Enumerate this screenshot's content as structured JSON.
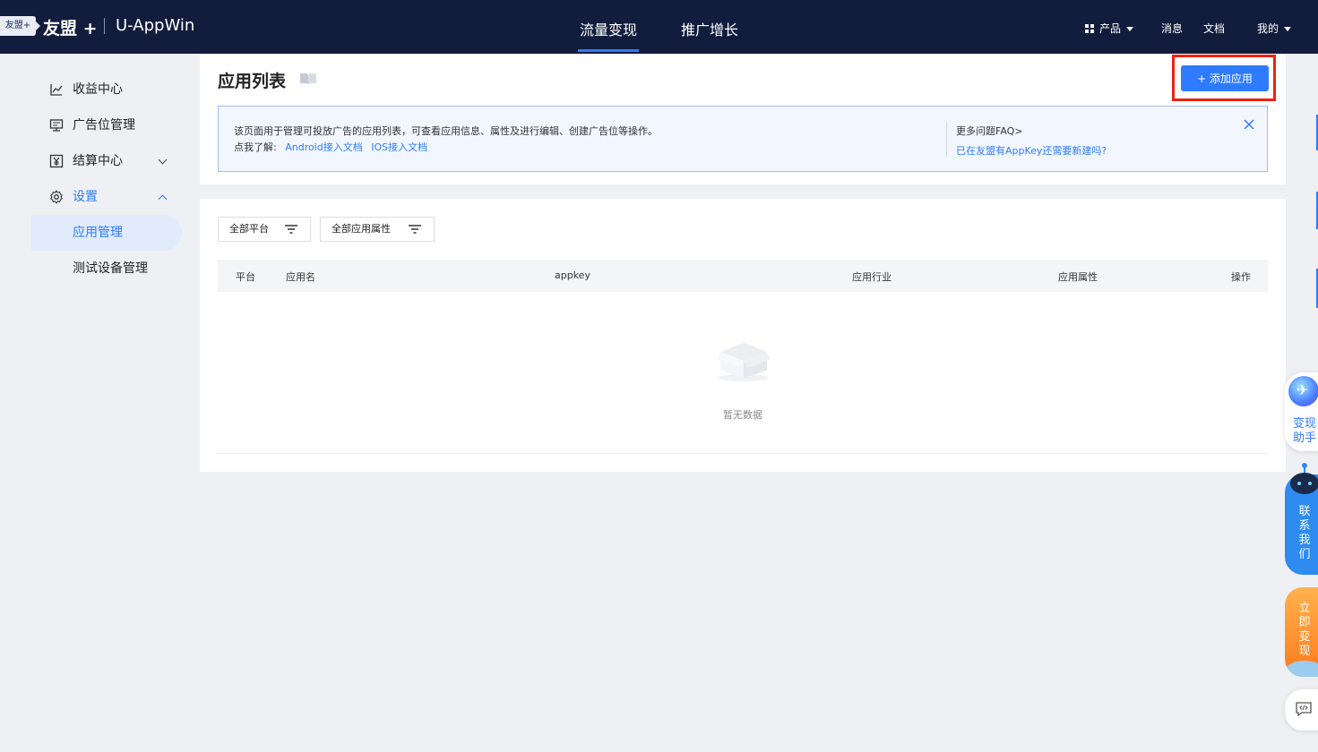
{
  "topbar": {
    "logo_badge": "友盟+",
    "brand": "友盟 +",
    "brand_sub": "U-AppWin",
    "tabs": [
      {
        "label": "流量变现",
        "active": true
      },
      {
        "label": "推广增长",
        "active": false
      }
    ],
    "right": {
      "products": "产品",
      "messages": "消息",
      "docs": "文档",
      "mine": "我的"
    }
  },
  "sidebar": {
    "items": [
      {
        "label": "收益中心",
        "icon": "chart-line-icon"
      },
      {
        "label": "广告位管理",
        "icon": "monitor-icon"
      },
      {
        "label": "结算中心",
        "icon": "yen-icon"
      },
      {
        "label": "设置",
        "icon": "gear-icon",
        "expanded": true
      },
      {
        "label": "应用管理",
        "selected": true
      },
      {
        "label": "测试设备管理"
      }
    ]
  },
  "header": {
    "title": "应用列表",
    "add_button": "+ 添加应用",
    "notice": {
      "text": "该页面用于管理可投放广告的应用列表，可查看应用信息、属性及进行编辑、创建广告位等操作。",
      "learn_prefix": "点我了解:",
      "android_link": "Android接入文档",
      "ios_link": "IOS接入文档",
      "faq_title": "更多问题FAQ>",
      "faq_link": "已在友盟有AppKey还需要新建吗?"
    }
  },
  "filters": {
    "platform": "全部平台",
    "attribute": "全部应用属性"
  },
  "table": {
    "columns": [
      "平台",
      "应用名",
      "appkey",
      "应用行业",
      "应用属性",
      "操作"
    ],
    "rows": [],
    "empty_text": "暂无数据"
  },
  "floating": {
    "assistant": "变现助手",
    "contact": "联系我们",
    "monetize": "立即变现"
  },
  "colors": {
    "topbar": "#121c3c",
    "accent": "#2e7bff",
    "highlight_frame": "#f02011"
  }
}
